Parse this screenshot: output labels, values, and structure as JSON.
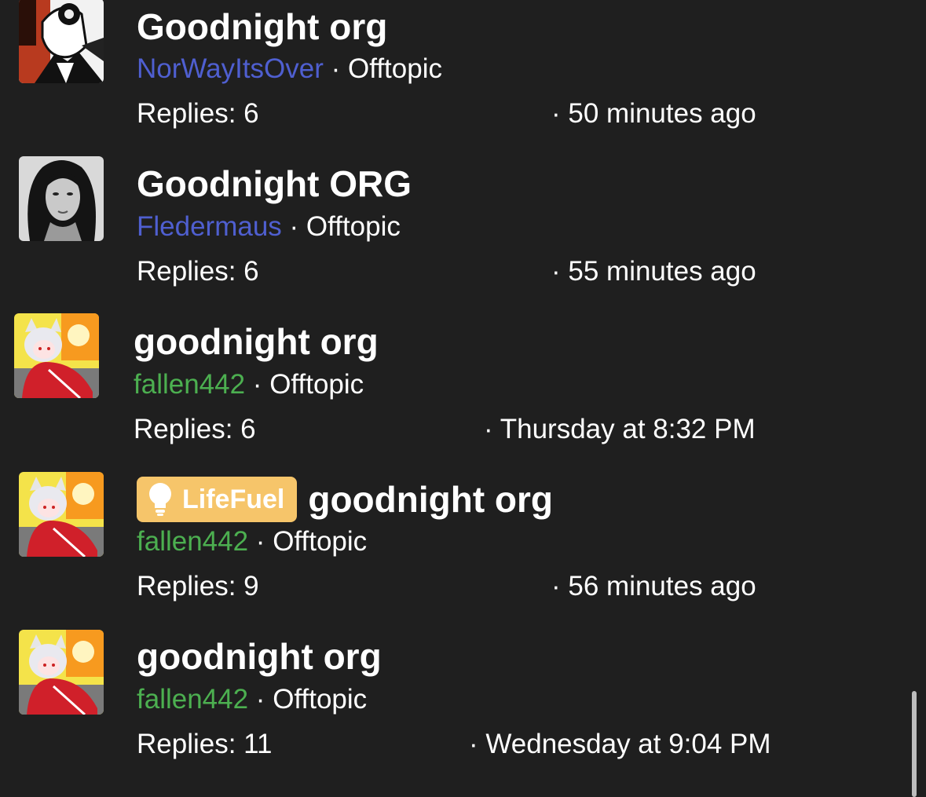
{
  "threads": [
    {
      "title": "Goodnight org",
      "prefix": "",
      "author": "NorWayItsOver",
      "author_color": "#4f5fd0",
      "separator": " · ",
      "forum": "Offtopic",
      "replies": "Replies: 6",
      "time": "· 50 minutes ago",
      "avatar_icon": "noir-masked-figure-avatar"
    },
    {
      "title": "Goodnight ORG",
      "prefix": "",
      "author": "Fledermaus",
      "author_color": "#4f5fd0",
      "separator": " · ",
      "forum": "Offtopic",
      "replies": "Replies: 6",
      "time": "· 55 minutes ago",
      "avatar_icon": "dark-haired-woman-avatar"
    },
    {
      "title": "goodnight org",
      "prefix": "",
      "author": "fallen442",
      "author_color": "#4caf50",
      "separator": " · ",
      "forum": "Offtopic",
      "replies": "Replies: 6",
      "time": "· Thursday at 8:32 PM",
      "avatar_icon": "anime-catgirl-avatar"
    },
    {
      "title": "goodnight org",
      "prefix": "LifeFuel",
      "prefix_color": "#f6c56a",
      "author": "fallen442",
      "author_color": "#4caf50",
      "separator": " · ",
      "forum": "Offtopic",
      "replies": "Replies: 9",
      "time": "· 56 minutes ago",
      "avatar_icon": "anime-catgirl-avatar"
    },
    {
      "title": "goodnight org",
      "prefix": "",
      "author": "fallen442",
      "author_color": "#4caf50",
      "separator": " · ",
      "forum": "Offtopic",
      "replies": "Replies: 11",
      "time": "· Wednesday at 9:04 PM",
      "avatar_icon": "anime-catgirl-avatar"
    }
  ]
}
